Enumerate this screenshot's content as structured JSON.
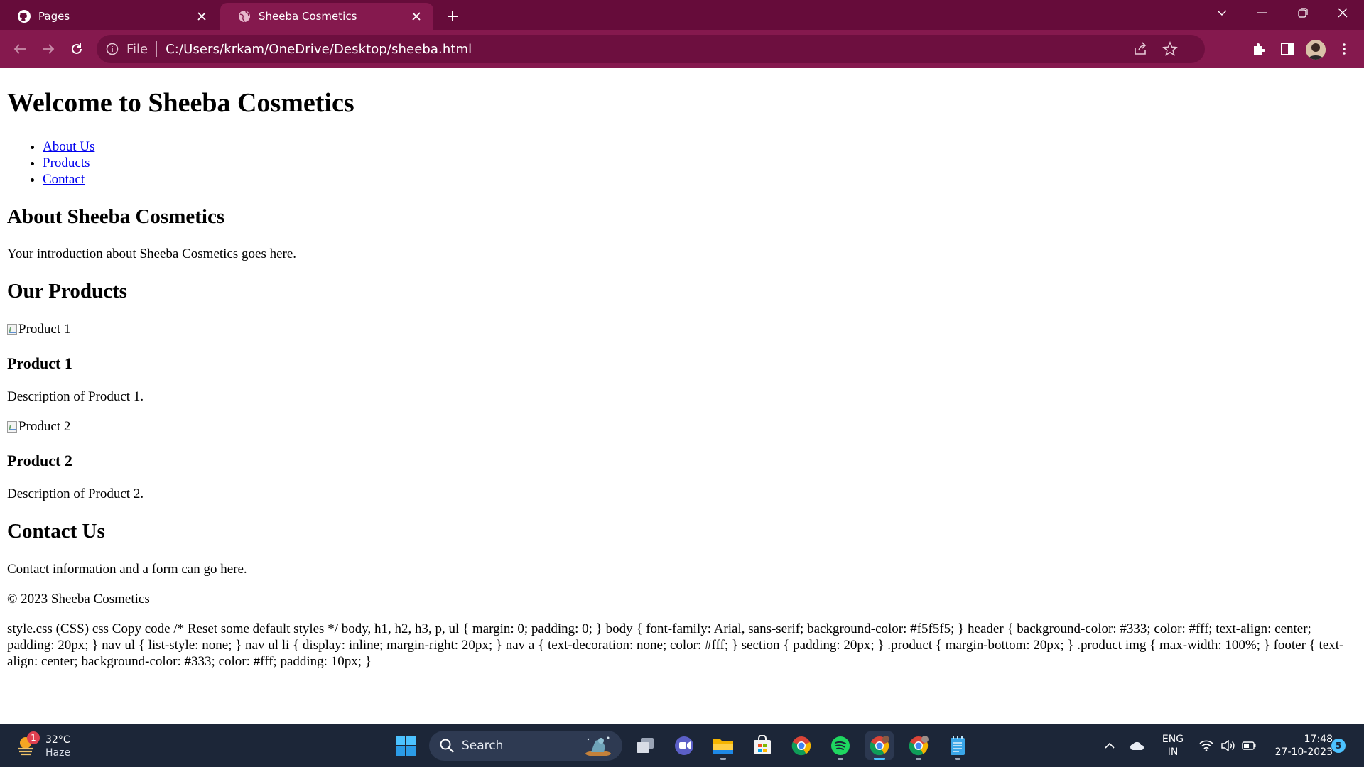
{
  "browser": {
    "tabs": [
      {
        "title": "Pages",
        "icon": "github-icon",
        "active": false
      },
      {
        "title": "Sheeba Cosmetics",
        "icon": "globe-icon",
        "active": true
      }
    ],
    "address": {
      "scheme_label": "File",
      "url": "C:/Users/krkam/OneDrive/Desktop/sheeba.html"
    },
    "theme": {
      "tabbar": "#660c3a",
      "toolbar": "#85194e",
      "omnibox": "#6d0f3f"
    }
  },
  "page": {
    "title": "Welcome to Sheeba Cosmetics",
    "nav": [
      "About Us",
      "Products",
      "Contact"
    ],
    "about": {
      "heading": "About Sheeba Cosmetics",
      "text": "Your introduction about Sheeba Cosmetics goes here."
    },
    "products": {
      "heading": "Our Products",
      "items": [
        {
          "img_alt": "Product 1",
          "name": "Product 1",
          "description": "Description of Product 1."
        },
        {
          "img_alt": "Product 2",
          "name": "Product 2",
          "description": "Description of Product 2."
        }
      ]
    },
    "contact": {
      "heading": "Contact Us",
      "text": "Contact information and a form can go here."
    },
    "footer": "© 2023 Sheeba Cosmetics",
    "code_dump": "style.css (CSS) css Copy code /* Reset some default styles */ body, h1, h2, h3, p, ul { margin: 0; padding: 0; } body { font-family: Arial, sans-serif; background-color: #f5f5f5; } header { background-color: #333; color: #fff; text-align: center; padding: 20px; } nav ul { list-style: none; } nav ul li { display: inline; margin-right: 20px; } nav a { text-decoration: none; color: #fff; } section { padding: 20px; } .product { margin-bottom: 20px; } .product img { max-width: 100%; } footer { text-align: center; background-color: #333; color: #fff; padding: 10px; }"
  },
  "taskbar": {
    "weather": {
      "temp": "32°C",
      "condition": "Haze",
      "badge": "1"
    },
    "search_label": "Search",
    "apps": [
      "file-explorer-icon",
      "teams-icon",
      "folder-icon",
      "store-icon",
      "chrome-icon",
      "spotify-icon",
      "chrome-icon",
      "chrome-icon",
      "notepad-icon"
    ],
    "language": {
      "line1": "ENG",
      "line2": "IN"
    },
    "clock": {
      "time": "17:48",
      "date": "27-10-2023"
    },
    "notifications": "5"
  }
}
